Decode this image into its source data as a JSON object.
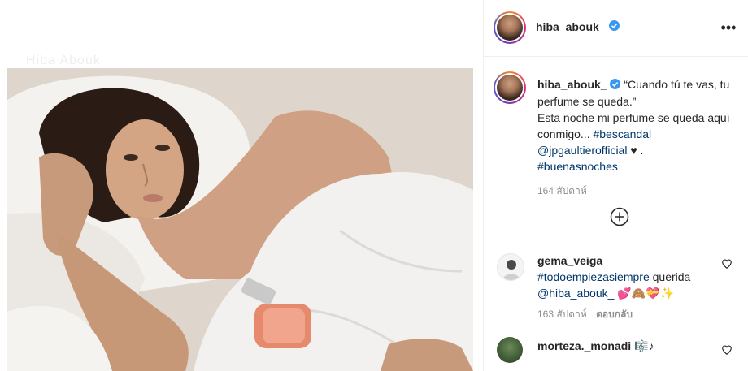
{
  "post": {
    "faint_text": "Hiba Abouk"
  },
  "header": {
    "username": "hiba_abouk_",
    "more_label": "•••"
  },
  "caption": {
    "username": "hiba_abouk_",
    "text_part1": " “Cuando tú te vas, tu perfume se queda.”",
    "text_part2": "Esta noche mi perfume se queda aquí conmigo... ",
    "hashtag1": "#bescandal",
    "mention1": "@jpgaultierofficial",
    "heart_dot": " ♥ .",
    "hashtag2": "#buenasnoches",
    "time": "164 สัปดาห์"
  },
  "comments": [
    {
      "username": "gema_veiga",
      "hashtag": "#todoempiezasiempre",
      "text_after_hashtag": " querida",
      "mention": "@hiba_abouk_",
      "emojis": " 💕🙈💝✨",
      "time": "163 สัปดาห์",
      "reply_label": "ตอบกลับ"
    },
    {
      "username": "morteza._monadi",
      "emojis": " 🎼♪"
    }
  ],
  "colors": {
    "link": "#00376b",
    "verified": "#3897f0",
    "muted": "#8e8e8e"
  },
  "icons": [
    "verified-badge-icon",
    "more-options-icon",
    "load-more-comments-icon",
    "heart-icon"
  ]
}
